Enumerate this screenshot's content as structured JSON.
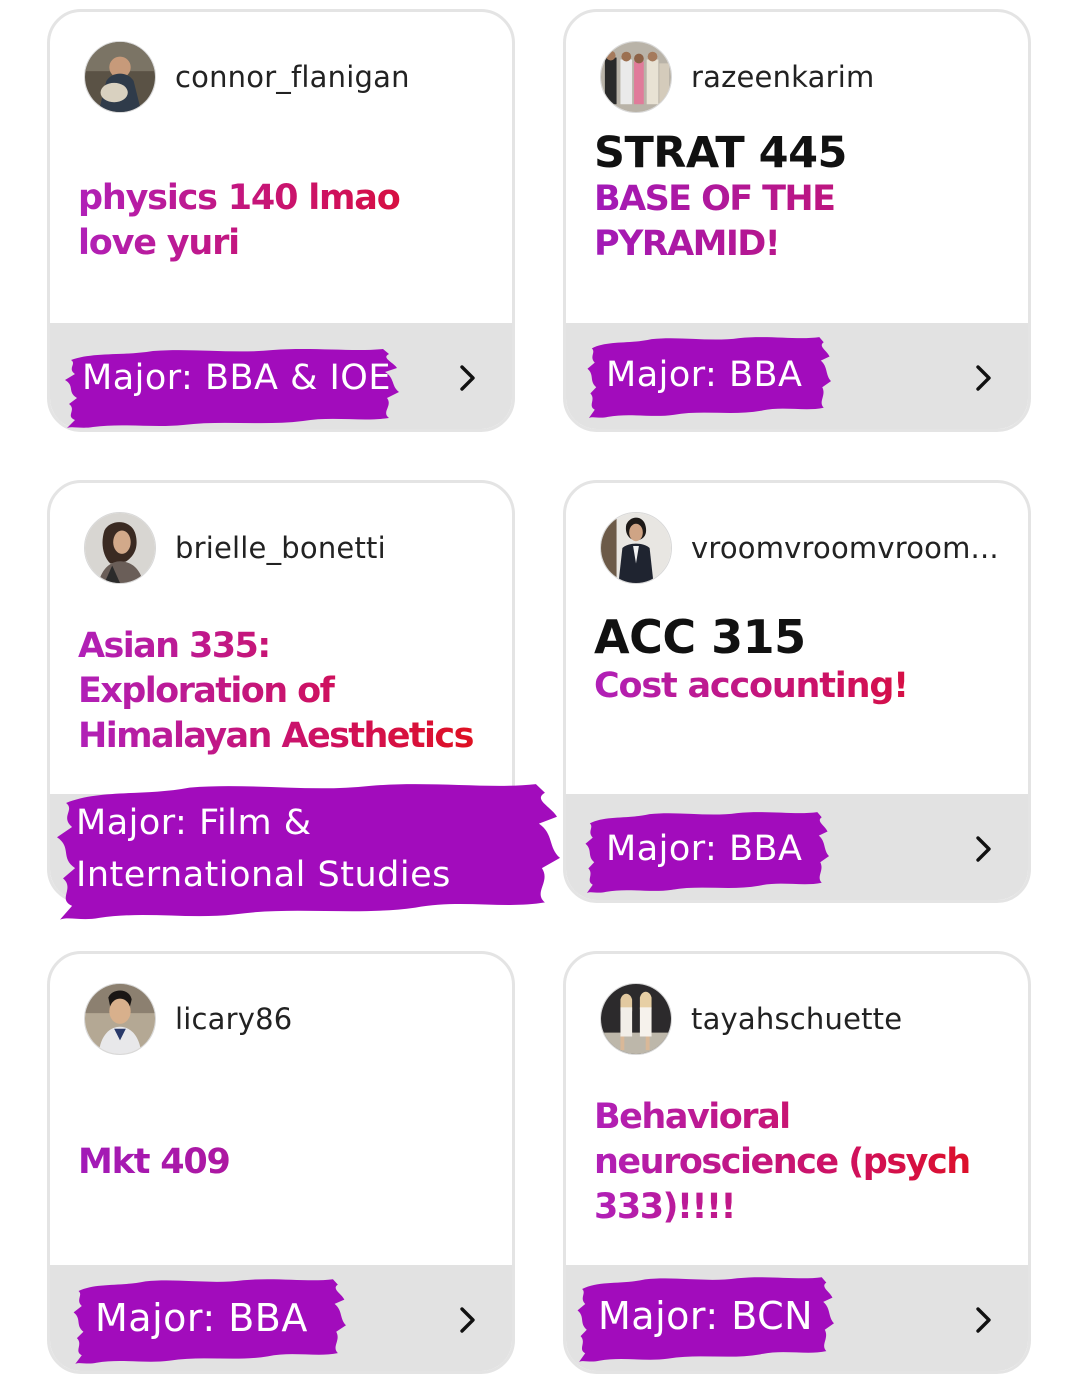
{
  "colors": {
    "brush": "#a20cbc",
    "card_footer": "#e2e2e2",
    "card_border": "#e4e4e4",
    "course_gradient_start": "#b020b8",
    "course_gradient_end": "#e0101c"
  },
  "cards": [
    {
      "username": "connor_flanigan",
      "course_code": "",
      "course_desc": "physics 140 lmao love yuri",
      "major": "Major: BBA & IOE",
      "avatar_icon": "avatar-photo-icon",
      "chevron_icon": "chevron-right-icon"
    },
    {
      "username": "razeenkarim",
      "course_code": "STRAT 445",
      "course_desc": "BASE OF THE PYRAMID!",
      "major": "Major: BBA",
      "avatar_icon": "avatar-photo-icon",
      "chevron_icon": "chevron-right-icon"
    },
    {
      "username": "brielle_bonetti",
      "course_code": "",
      "course_desc": "Asian 335: Exploration of Himalayan Aesthetics",
      "major_line1": "Major: Film &",
      "major_line2": "International Studies",
      "avatar_icon": "avatar-photo-icon"
    },
    {
      "username": "vroomvroomvroom...",
      "course_code": "ACC 315",
      "course_desc": "Cost accounting!",
      "major": "Major: BBA",
      "avatar_icon": "avatar-photo-icon",
      "chevron_icon": "chevron-right-icon"
    },
    {
      "username": "licary86",
      "course_code": "",
      "course_desc": "Mkt 409",
      "major": "Major: BBA",
      "avatar_icon": "avatar-photo-icon",
      "chevron_icon": "chevron-right-icon"
    },
    {
      "username": "tayahschuette",
      "course_code": "",
      "course_desc": "Behavioral neuroscience (psych 333)!!!!",
      "major": "Major: BCN",
      "avatar_icon": "avatar-photo-icon",
      "chevron_icon": "chevron-right-icon"
    }
  ]
}
